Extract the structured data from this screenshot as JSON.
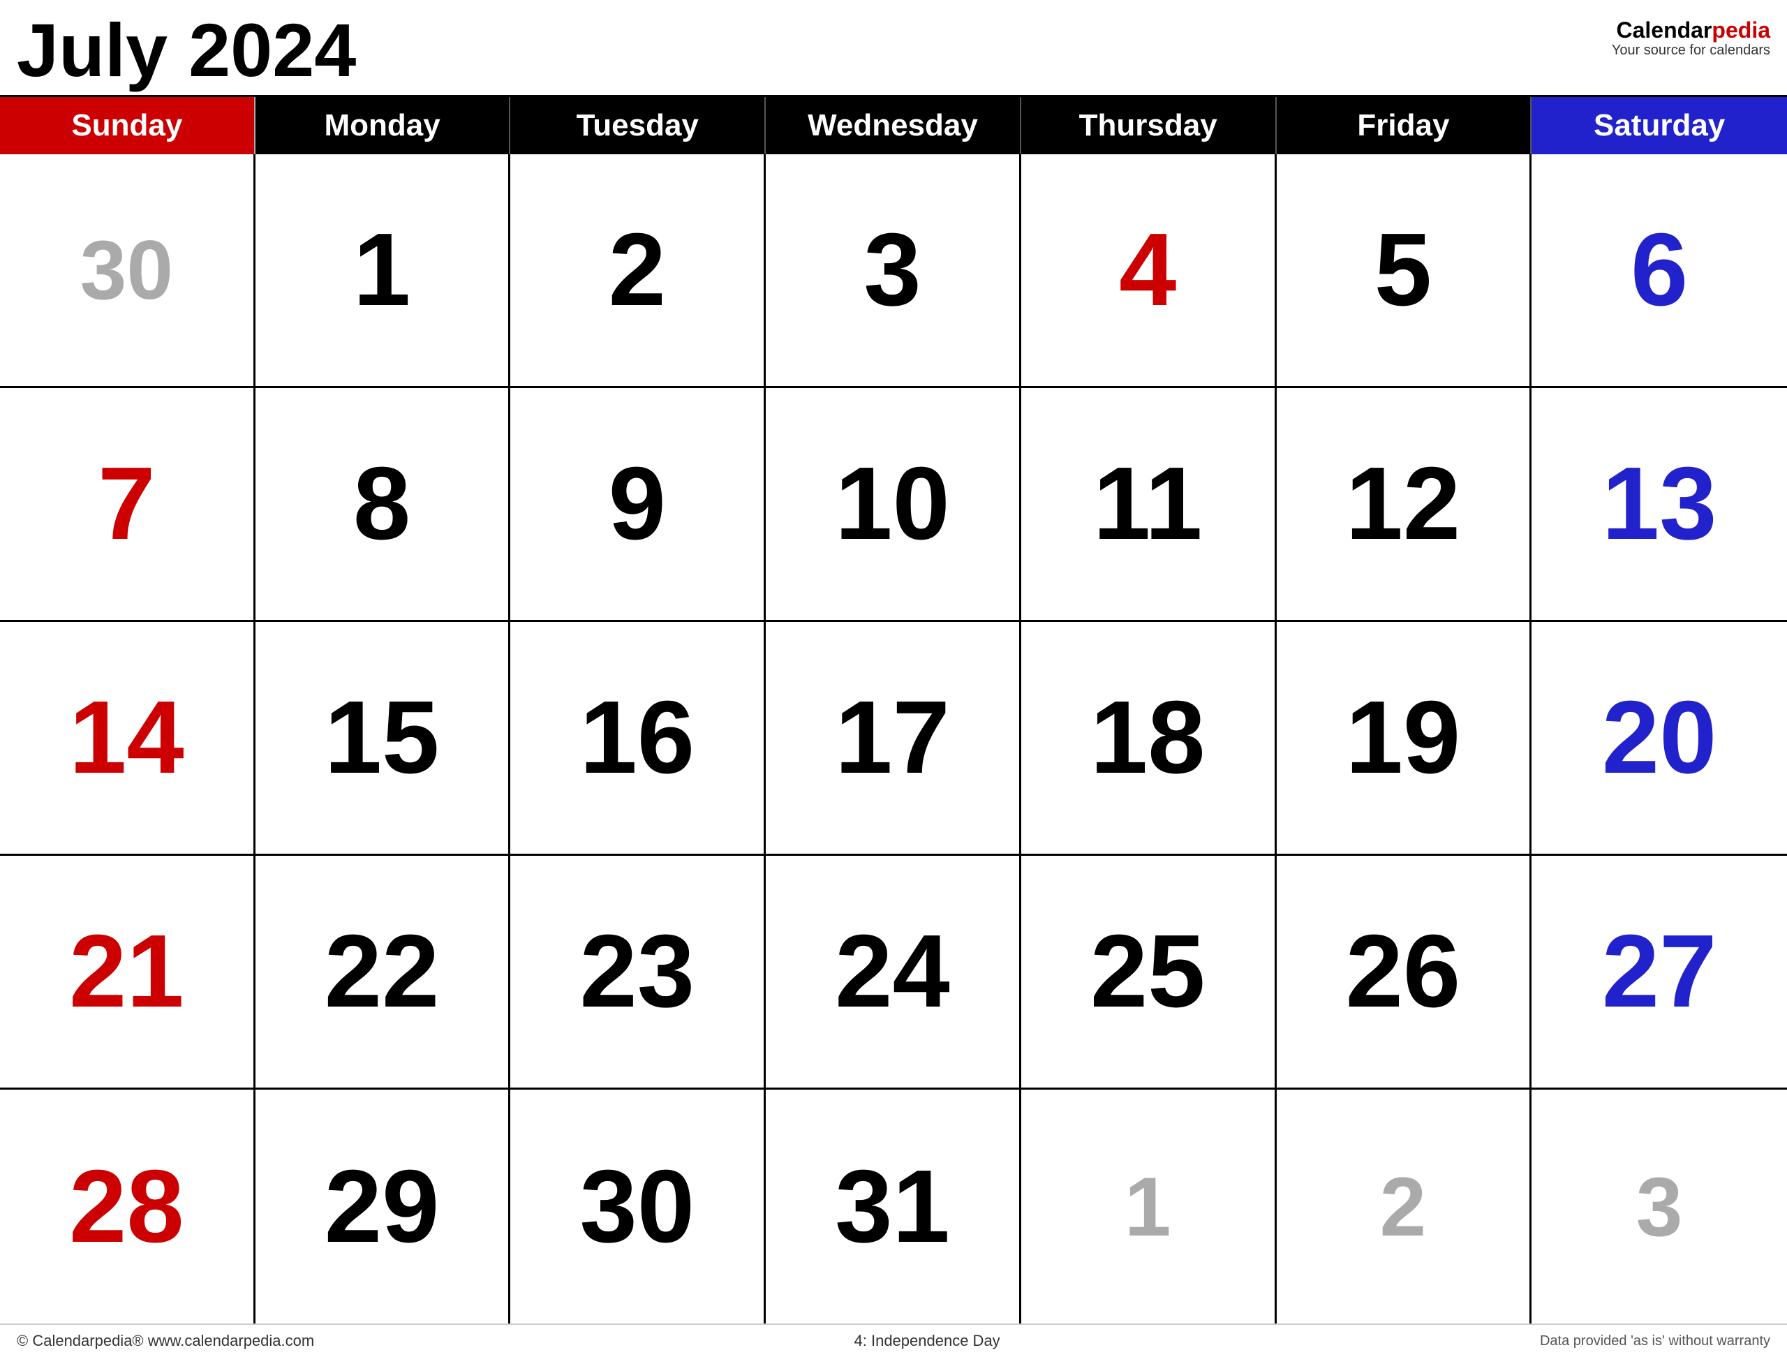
{
  "header": {
    "title": "July 2024",
    "logo_name": "Calendarpedia",
    "logo_name_plain": "Calendar",
    "logo_name_accent": "pedia",
    "logo_subtitle": "Your source for calendars"
  },
  "day_headers": [
    {
      "label": "Sunday",
      "type": "sunday"
    },
    {
      "label": "Monday",
      "type": "weekday"
    },
    {
      "label": "Tuesday",
      "type": "weekday"
    },
    {
      "label": "Wednesday",
      "type": "weekday"
    },
    {
      "label": "Thursday",
      "type": "weekday"
    },
    {
      "label": "Friday",
      "type": "weekday"
    },
    {
      "label": "Saturday",
      "type": "saturday"
    }
  ],
  "weeks": [
    [
      {
        "day": "30",
        "type": "outside-month"
      },
      {
        "day": "1",
        "type": "weekday"
      },
      {
        "day": "2",
        "type": "weekday"
      },
      {
        "day": "3",
        "type": "weekday"
      },
      {
        "day": "4",
        "type": "holiday"
      },
      {
        "day": "5",
        "type": "weekday"
      },
      {
        "day": "6",
        "type": "saturday"
      }
    ],
    [
      {
        "day": "7",
        "type": "sunday"
      },
      {
        "day": "8",
        "type": "weekday"
      },
      {
        "day": "9",
        "type": "weekday"
      },
      {
        "day": "10",
        "type": "weekday"
      },
      {
        "day": "11",
        "type": "weekday"
      },
      {
        "day": "12",
        "type": "weekday"
      },
      {
        "day": "13",
        "type": "saturday"
      }
    ],
    [
      {
        "day": "14",
        "type": "sunday"
      },
      {
        "day": "15",
        "type": "weekday"
      },
      {
        "day": "16",
        "type": "weekday"
      },
      {
        "day": "17",
        "type": "weekday"
      },
      {
        "day": "18",
        "type": "weekday"
      },
      {
        "day": "19",
        "type": "weekday"
      },
      {
        "day": "20",
        "type": "saturday"
      }
    ],
    [
      {
        "day": "21",
        "type": "sunday"
      },
      {
        "day": "22",
        "type": "weekday"
      },
      {
        "day": "23",
        "type": "weekday"
      },
      {
        "day": "24",
        "type": "weekday"
      },
      {
        "day": "25",
        "type": "weekday"
      },
      {
        "day": "26",
        "type": "weekday"
      },
      {
        "day": "27",
        "type": "saturday"
      }
    ],
    [
      {
        "day": "28",
        "type": "sunday"
      },
      {
        "day": "29",
        "type": "weekday"
      },
      {
        "day": "30",
        "type": "weekday"
      },
      {
        "day": "31",
        "type": "weekday"
      },
      {
        "day": "1",
        "type": "outside-month"
      },
      {
        "day": "2",
        "type": "outside-month"
      },
      {
        "day": "3",
        "type": "outside-month"
      }
    ]
  ],
  "footer": {
    "left": "© Calendarpedia®   www.calendarpedia.com",
    "center": "4: Independence Day",
    "right": "Data provided 'as is' without warranty"
  }
}
